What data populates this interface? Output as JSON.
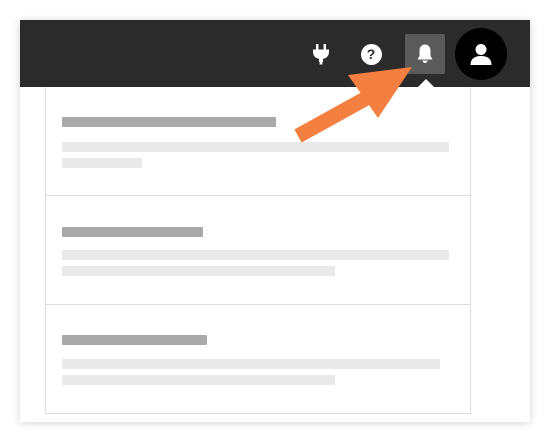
{
  "topbar": {
    "background": "#2b2b2b",
    "icons": {
      "integrations": "plug-icon",
      "help_glyph": "?",
      "notifications": "bell-icon",
      "profile": "user-icon"
    }
  },
  "notifications": [
    {
      "title": "",
      "body": ""
    },
    {
      "title": "",
      "body": ""
    },
    {
      "title": "",
      "body": ""
    }
  ],
  "annotation": {
    "color": "#f37f40",
    "points_to": "bell-icon"
  }
}
